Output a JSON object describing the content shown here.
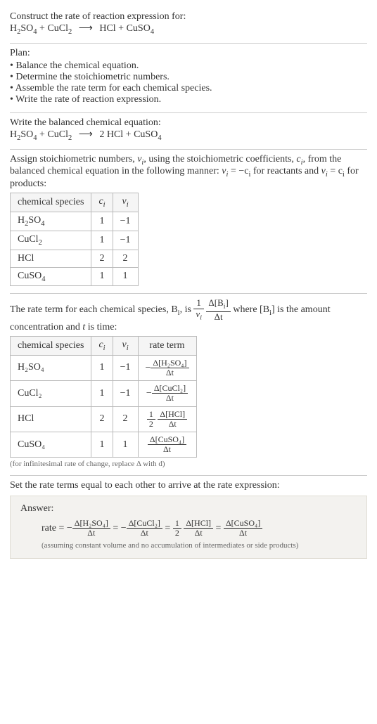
{
  "prompt": {
    "line1": "Construct the rate of reaction expression for:",
    "eq_lhs1": "H",
    "eq_lhs1_sub": "2",
    "eq_lhs2": "SO",
    "eq_lhs2_sub": "4",
    "plus1": " + ",
    "eq_lhs3": "CuCl",
    "eq_lhs3_sub": "2",
    "arrow": "⟶",
    "eq_rhs1": "HCl + CuSO",
    "eq_rhs1_sub": "4"
  },
  "plan": {
    "heading": "Plan:",
    "items": [
      "Balance the chemical equation.",
      "Determine the stoichiometric numbers.",
      "Assemble the rate term for each chemical species.",
      "Write the rate of reaction expression."
    ]
  },
  "balanced": {
    "heading": "Write the balanced chemical equation:",
    "lhs1": "H",
    "lhs1_sub": "2",
    "lhs2": "SO",
    "lhs2_sub": "4",
    "plus1": " + ",
    "lhs3": "CuCl",
    "lhs3_sub": "2",
    "arrow": "⟶",
    "rhs_coef": " 2 ",
    "rhs1": "HCl + CuSO",
    "rhs1_sub": "4"
  },
  "stoich": {
    "text_a": "Assign stoichiometric numbers, ",
    "nu_i": "ν",
    "nu_i_sub": "i",
    "text_b": ", using the stoichiometric coefficients, ",
    "c_i": "c",
    "c_i_sub": "i",
    "text_c": ", from the balanced chemical equation in the following manner: ",
    "rel1": "ν",
    "rel1_sub": "i",
    "rel1_eq": " = −c",
    "rel1_eq_sub": "i",
    "text_d": " for reactants and ",
    "rel2": "ν",
    "rel2_sub": "i",
    "rel2_eq": " = c",
    "rel2_eq_sub": "i",
    "text_e": " for products:",
    "table": {
      "h1": "chemical species",
      "h2": "c",
      "h2_sub": "i",
      "h3": "ν",
      "h3_sub": "i",
      "rows": [
        {
          "sp_a": "H",
          "sp_a_sub": "2",
          "sp_b": "SO",
          "sp_b_sub": "4",
          "c": "1",
          "nu": "−1"
        },
        {
          "sp_a": "CuCl",
          "sp_a_sub": "2",
          "sp_b": "",
          "sp_b_sub": "",
          "c": "1",
          "nu": "−1"
        },
        {
          "sp_a": "HCl",
          "sp_a_sub": "",
          "sp_b": "",
          "sp_b_sub": "",
          "c": "2",
          "nu": "2"
        },
        {
          "sp_a": "CuSO",
          "sp_a_sub": "4",
          "sp_b": "",
          "sp_b_sub": "",
          "c": "1",
          "nu": "1"
        }
      ]
    }
  },
  "rateterm": {
    "text_a": "The rate term for each chemical species, B",
    "sub_i": "i",
    "text_b": ", is ",
    "frac1_num": "1",
    "frac1_den_a": "ν",
    "frac1_den_sub": "i",
    "frac2_num": "Δ[B",
    "frac2_num_sub": "i",
    "frac2_num_close": "]",
    "frac2_den": "Δt",
    "text_c": " where [B",
    "text_c_sub": "i",
    "text_d": "] is the amount concentration and ",
    "it_t": "t",
    "text_e": " is time:",
    "table": {
      "h1": "chemical species",
      "h2": "c",
      "h2_sub": "i",
      "h3": "ν",
      "h3_sub": "i",
      "h4": "rate term",
      "rows": [
        {
          "sp": "H₂SO₄",
          "c": "1",
          "nu": "−1",
          "rt_sign": "−",
          "rt_num": "Δ[H₂SO₄]",
          "rt_den": "Δt",
          "rt_coef": ""
        },
        {
          "sp": "CuCl₂",
          "c": "1",
          "nu": "−1",
          "rt_sign": "−",
          "rt_num": "Δ[CuCl₂]",
          "rt_den": "Δt",
          "rt_coef": ""
        },
        {
          "sp": "HCl",
          "c": "2",
          "nu": "2",
          "rt_sign": "",
          "rt_num": "Δ[HCl]",
          "rt_den": "Δt",
          "rt_coef_num": "1",
          "rt_coef_den": "2"
        },
        {
          "sp": "CuSO₄",
          "c": "1",
          "nu": "1",
          "rt_sign": "",
          "rt_num": "Δ[CuSO₄]",
          "rt_den": "Δt",
          "rt_coef": ""
        }
      ]
    },
    "footnote": "(for infinitesimal rate of change, replace Δ with d)"
  },
  "final": {
    "heading": "Set the rate terms equal to each other to arrive at the rate expression:",
    "answer_label": "Answer:",
    "rate_label": "rate = ",
    "neg": "−",
    "t1_num": "Δ[H₂SO₄]",
    "t1_den": "Δt",
    "eq": " = ",
    "t2_num": "Δ[CuCl₂]",
    "t2_den": "Δt",
    "t3_coef_num": "1",
    "t3_coef_den": "2",
    "t3_num": "Δ[HCl]",
    "t3_den": "Δt",
    "t4_num": "Δ[CuSO₄]",
    "t4_den": "Δt",
    "note": "(assuming constant volume and no accumulation of intermediates or side products)"
  },
  "chart_data": {
    "type": "table",
    "tables": [
      {
        "title": "Stoichiometric numbers",
        "columns": [
          "chemical species",
          "c_i",
          "ν_i"
        ],
        "rows": [
          [
            "H2SO4",
            1,
            -1
          ],
          [
            "CuCl2",
            1,
            -1
          ],
          [
            "HCl",
            2,
            2
          ],
          [
            "CuSO4",
            1,
            1
          ]
        ]
      },
      {
        "title": "Rate terms",
        "columns": [
          "chemical species",
          "c_i",
          "ν_i",
          "rate term"
        ],
        "rows": [
          [
            "H2SO4",
            1,
            -1,
            "-Δ[H2SO4]/Δt"
          ],
          [
            "CuCl2",
            1,
            -1,
            "-Δ[CuCl2]/Δt"
          ],
          [
            "HCl",
            2,
            2,
            "(1/2) Δ[HCl]/Δt"
          ],
          [
            "CuSO4",
            1,
            1,
            "Δ[CuSO4]/Δt"
          ]
        ]
      }
    ],
    "balanced_equation": "H2SO4 + CuCl2 → 2 HCl + CuSO4",
    "rate_expression": "rate = -Δ[H2SO4]/Δt = -Δ[CuCl2]/Δt = (1/2) Δ[HCl]/Δt = Δ[CuSO4]/Δt"
  }
}
